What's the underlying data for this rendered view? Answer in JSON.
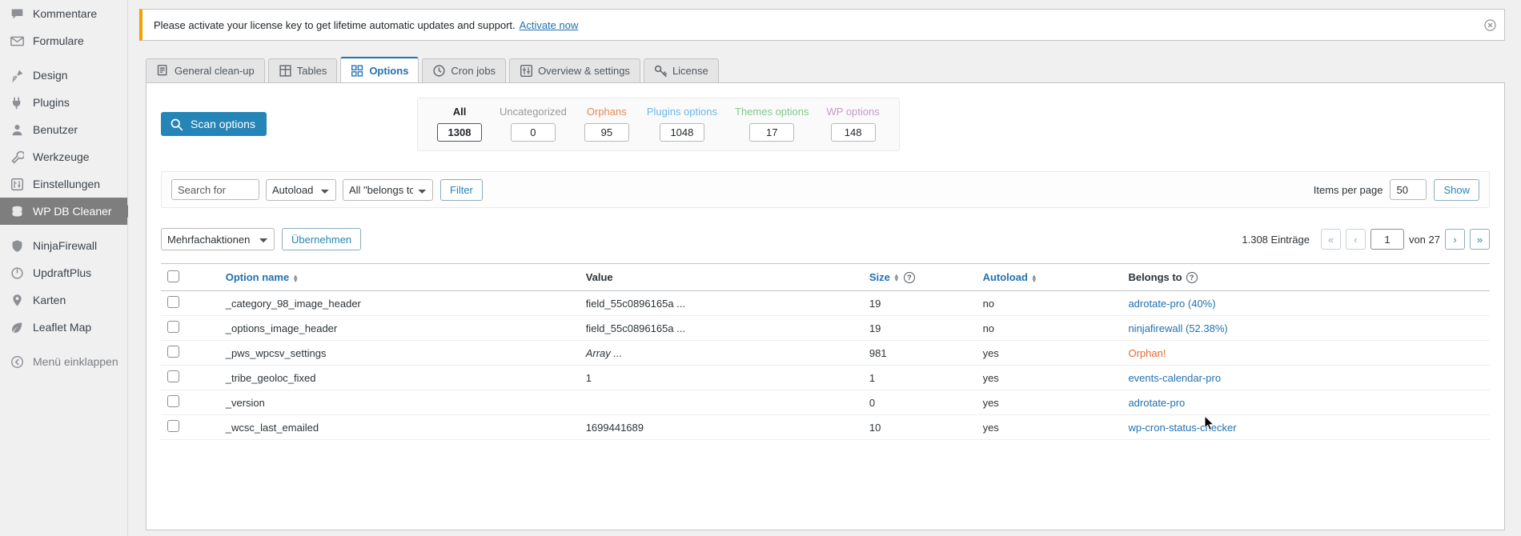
{
  "sidebar": {
    "items": [
      {
        "label": "Kommentare",
        "icon": "comments-icon",
        "current": false,
        "gap_after": false
      },
      {
        "label": "Formulare",
        "icon": "envelope-icon",
        "current": false,
        "gap_after": true
      },
      {
        "label": "Design",
        "icon": "brush-icon",
        "current": false,
        "gap_after": false
      },
      {
        "label": "Plugins",
        "icon": "plug-icon",
        "current": false,
        "gap_after": false
      },
      {
        "label": "Benutzer",
        "icon": "user-icon",
        "current": false,
        "gap_after": false
      },
      {
        "label": "Werkzeuge",
        "icon": "wrench-icon",
        "current": false,
        "gap_after": false
      },
      {
        "label": "Einstellungen",
        "icon": "sliders-icon",
        "current": false,
        "gap_after": false
      },
      {
        "label": "WP DB Cleaner",
        "icon": "database-icon",
        "current": true,
        "gap_after": true
      },
      {
        "label": "NinjaFirewall",
        "icon": "shield-icon",
        "current": false,
        "gap_after": false
      },
      {
        "label": "UpdraftPlus",
        "icon": "power-icon",
        "current": false,
        "gap_after": false
      },
      {
        "label": "Karten",
        "icon": "map-pin-icon",
        "current": false,
        "gap_after": false
      },
      {
        "label": "Leaflet Map",
        "icon": "leaf-icon",
        "current": false,
        "gap_after": true
      },
      {
        "label": "Menü einklappen",
        "icon": "collapse-icon",
        "current": false,
        "gap_after": false
      }
    ]
  },
  "notice": {
    "text": "Please activate your license key to get lifetime automatic updates and support.",
    "link_label": "Activate now",
    "dismiss_icon": "close-circle-icon"
  },
  "tabs": [
    {
      "label": "General clean-up",
      "icon": "broom-list-icon",
      "active": false
    },
    {
      "label": "Tables",
      "icon": "grid-icon",
      "active": false
    },
    {
      "label": "Options",
      "icon": "options-grid-icon",
      "active": true
    },
    {
      "label": "Cron jobs",
      "icon": "clock-icon",
      "active": false
    },
    {
      "label": "Overview & settings",
      "icon": "settings-icon",
      "active": false
    },
    {
      "label": "License",
      "icon": "key-icon",
      "active": false
    }
  ],
  "scan_button": {
    "label": "Scan options",
    "icon": "search-icon"
  },
  "stats": [
    {
      "label": "All",
      "value": "1308",
      "active": true,
      "color": "#1d2327"
    },
    {
      "label": "Uncategorized",
      "value": "0",
      "active": false,
      "color": "#999999"
    },
    {
      "label": "Orphans",
      "value": "95",
      "active": false,
      "color": "#e08a5a"
    },
    {
      "label": "Plugins options",
      "value": "1048",
      "active": false,
      "color": "#6ab7e8"
    },
    {
      "label": "Themes options",
      "value": "17",
      "active": false,
      "color": "#7fc98a"
    },
    {
      "label": "WP options",
      "value": "148",
      "active": false,
      "color": "#c79ac7"
    }
  ],
  "filterbar": {
    "search_placeholder": "Search for",
    "search_value": "",
    "autoload_select": "Autoload",
    "belongs_select": "All \"belongs to\"",
    "filter_button": "Filter",
    "items_per_page_label": "Items per page",
    "items_per_page_value": "50",
    "show_button": "Show"
  },
  "bulk": {
    "action_select": "Mehrfachaktionen",
    "apply_button": "Übernehmen"
  },
  "pagination": {
    "entries_label": "1.308 Einträge",
    "first_icon": "«",
    "prev_icon": "‹",
    "current_page": "1",
    "of_label": "von 27",
    "next_icon": "›",
    "last_icon": "»"
  },
  "table": {
    "headers": [
      {
        "label": "Option name",
        "sortable": true,
        "help": false
      },
      {
        "label": "Value",
        "sortable": false,
        "help": false
      },
      {
        "label": "Size",
        "sortable": true,
        "help": true
      },
      {
        "label": "Autoload",
        "sortable": true,
        "help": false
      },
      {
        "label": "Belongs to",
        "sortable": false,
        "help": true
      }
    ],
    "rows": [
      {
        "name": "_category_98_image_header",
        "value": "field_55c0896165a ...",
        "value_italic": false,
        "size": "19",
        "autoload": "no",
        "belongs": "adrotate-pro (40%)",
        "orphan": false
      },
      {
        "name": "_options_image_header",
        "value": "field_55c0896165a ...",
        "value_italic": false,
        "size": "19",
        "autoload": "no",
        "belongs": "ninjafirewall (52.38%)",
        "orphan": false
      },
      {
        "name": "_pws_wpcsv_settings",
        "value": "Array ...",
        "value_italic": true,
        "size": "981",
        "autoload": "yes",
        "belongs": "Orphan!",
        "orphan": true
      },
      {
        "name": "_tribe_geoloc_fixed",
        "value": "1",
        "value_italic": false,
        "size": "1",
        "autoload": "yes",
        "belongs": "events-calendar-pro",
        "orphan": false
      },
      {
        "name": "_version",
        "value": "",
        "value_italic": false,
        "size": "0",
        "autoload": "yes",
        "belongs": "adrotate-pro",
        "orphan": false
      },
      {
        "name": "_wcsc_last_emailed",
        "value": "1699441689",
        "value_italic": false,
        "size": "10",
        "autoload": "yes",
        "belongs": "wp-cron-status-checker",
        "orphan": false
      }
    ]
  },
  "cursor": {
    "icon": "mouse-pointer-icon"
  }
}
